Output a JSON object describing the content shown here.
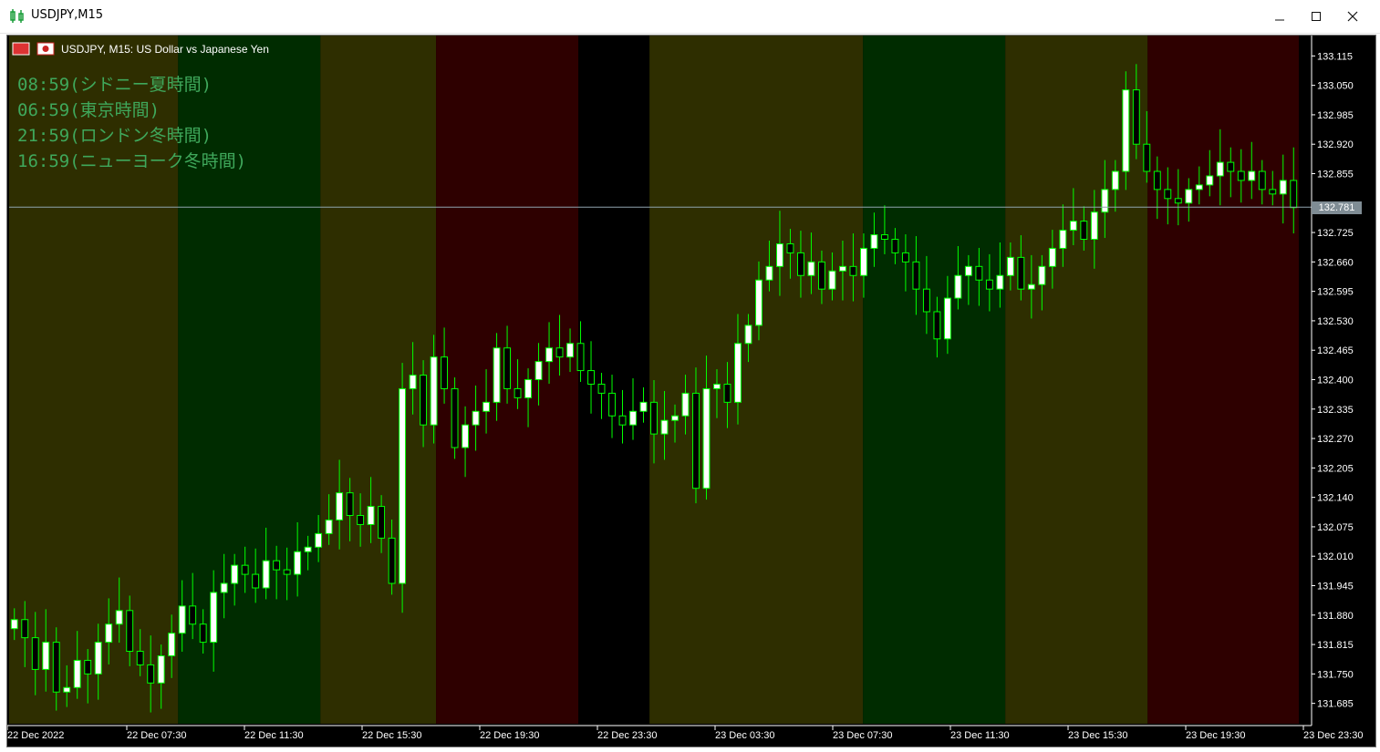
{
  "window": {
    "title": "USDJPY,M15",
    "minimize_icon": "minimize-icon",
    "maximize_icon": "maximize-icon",
    "close_icon": "close-icon"
  },
  "chart_header": {
    "text": "USDJPY, M15:  US Dollar vs Japanese Yen"
  },
  "overlay_labels": [
    "08:59(シドニー夏時間)",
    "06:59(東京時間)",
    "21:59(ロンドン冬時間)",
    "16:59(ニューヨーク冬時間)"
  ],
  "current_price": "132.781",
  "colors": {
    "background": "#000000",
    "candle_up_fill": "#ffffff",
    "candle_down_fill": "#000000",
    "candle_outline": "#00ff00",
    "bid_line": "#8fa3ad",
    "label_text": "#3fa85b",
    "axis_text": "#ffffff",
    "session_sydney": "#2e2e00",
    "session_tokyo": "#002c00",
    "session_london": "#2e0000",
    "session_gap": "#000000"
  },
  "sessions": [
    {
      "start": 0,
      "end": 19,
      "color": "#2e2e00"
    },
    {
      "start": 19,
      "end": 35,
      "color": "#002c00"
    },
    {
      "start": 35,
      "end": 48,
      "color": "#2e2e00"
    },
    {
      "start": 48,
      "end": 64,
      "color": "#2e0000"
    },
    {
      "start": 64,
      "end": 72,
      "color": "#000000"
    },
    {
      "start": 72,
      "end": 96,
      "color": "#2e2e00"
    },
    {
      "start": 96,
      "end": 112,
      "color": "#002c00"
    },
    {
      "start": 112,
      "end": 128,
      "color": "#2e2e00"
    },
    {
      "start": 128,
      "end": 145,
      "color": "#2e0000"
    }
  ],
  "chart_data": {
    "type": "candlestick",
    "symbol": "USDJPY",
    "timeframe": "M15",
    "ylim": [
      131.64,
      133.16
    ],
    "y_ticks": [
      "133.115",
      "133.050",
      "132.985",
      "132.920",
      "132.855",
      "132.725",
      "132.660",
      "132.595",
      "132.530",
      "132.465",
      "132.400",
      "132.335",
      "132.270",
      "132.205",
      "132.140",
      "132.075",
      "132.010",
      "131.945",
      "131.880",
      "131.815",
      "131.750",
      "131.685"
    ],
    "x_ticks": [
      "22 Dec 2022",
      "22 Dec 07:30",
      "22 Dec 11:30",
      "22 Dec 15:30",
      "22 Dec 19:30",
      "22 Dec 23:30",
      "23 Dec 03:30",
      "23 Dec 07:30",
      "23 Dec 11:30",
      "23 Dec 15:30",
      "23 Dec 19:30",
      "23 Dec 23:30"
    ],
    "x_tick_candle_index": [
      0,
      16,
      32,
      48,
      64,
      80,
      96,
      112,
      128,
      144,
      160,
      176
    ],
    "total_candles": 178,
    "closes": [
      131.87,
      131.83,
      131.76,
      131.82,
      131.71,
      131.72,
      131.78,
      131.75,
      131.82,
      131.86,
      131.89,
      131.8,
      131.77,
      131.73,
      131.79,
      131.84,
      131.9,
      131.86,
      131.82,
      131.93,
      131.95,
      131.99,
      131.97,
      131.94,
      132.0,
      131.98,
      131.97,
      132.02,
      132.03,
      132.06,
      132.09,
      132.15,
      132.1,
      132.08,
      132.12,
      132.05,
      131.95,
      132.38,
      132.41,
      132.3,
      132.45,
      132.38,
      132.25,
      132.3,
      132.33,
      132.35,
      132.47,
      132.38,
      132.36,
      132.4,
      132.44,
      132.47,
      132.45,
      132.48,
      132.42,
      132.39,
      132.37,
      132.32,
      132.3,
      132.33,
      132.35,
      132.28,
      132.31,
      132.32,
      132.37,
      132.16,
      132.38,
      132.39,
      132.35,
      132.48,
      132.52,
      132.62,
      132.65,
      132.7,
      132.68,
      132.63,
      132.66,
      132.6,
      132.64,
      132.65,
      132.63,
      132.69,
      132.72,
      132.71,
      132.68,
      132.66,
      132.6,
      132.55,
      132.49,
      132.58,
      132.63,
      132.65,
      132.62,
      132.6,
      132.63,
      132.67,
      132.6,
      132.61,
      132.65,
      132.69,
      132.73,
      132.75,
      132.71,
      132.77,
      132.82,
      132.86,
      133.04,
      132.92,
      132.86,
      132.82,
      132.8,
      132.79,
      132.82,
      132.83,
      132.85,
      132.88,
      132.86,
      132.84,
      132.86,
      132.82,
      132.81,
      132.84,
      132.78
    ]
  },
  "axis_label_font": "11px"
}
